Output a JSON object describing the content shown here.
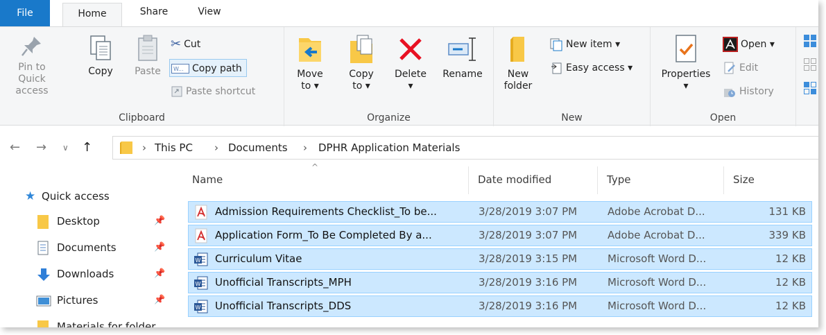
{
  "ribbon_tabs": {
    "file": "File",
    "home": "Home",
    "share": "Share",
    "view": "View"
  },
  "clipboard": {
    "pin": [
      "Pin to Quick",
      "access"
    ],
    "copy": "Copy",
    "paste": "Paste",
    "cut": "Cut",
    "copy_path": "Copy path",
    "paste_shortcut": "Paste shortcut",
    "label": "Clipboard"
  },
  "organize": {
    "move_to": [
      "Move",
      "to ▾"
    ],
    "copy_to": [
      "Copy",
      "to ▾"
    ],
    "delete": [
      "Delete",
      "▾"
    ],
    "rename": "Rename",
    "label": "Organize"
  },
  "new": {
    "new_folder": [
      "New",
      "folder"
    ],
    "new_item": "New item ▾",
    "easy_access": "Easy access ▾",
    "label": "New"
  },
  "open": {
    "properties": [
      "Properties",
      "▾"
    ],
    "open": "Open ▾",
    "edit": "Edit",
    "history": "History",
    "label": "Open"
  },
  "address": {
    "crumbs": [
      "This PC",
      "Documents",
      "DPHR  Application Materials"
    ]
  },
  "nav_pane": {
    "quick_access": "Quick access",
    "items": [
      "Desktop",
      "Documents",
      "Downloads",
      "Pictures",
      "Materials for folder"
    ]
  },
  "columns": {
    "name": "Name",
    "date": "Date modified",
    "type": "Type",
    "size": "Size"
  },
  "files": [
    {
      "icon": "pdf-icon",
      "name": "Admission Requirements Checklist_To be...",
      "date": "3/28/2019 3:07 PM",
      "type": "Adobe Acrobat D...",
      "size": "131 KB"
    },
    {
      "icon": "pdf-icon",
      "name": "Application Form_To Be Completed By a...",
      "date": "3/28/2019 3:07 PM",
      "type": "Adobe Acrobat D...",
      "size": "339 KB"
    },
    {
      "icon": "word-icon",
      "name": "Curriculum Vitae",
      "date": "3/28/2019 3:15 PM",
      "type": "Microsoft Word D...",
      "size": "12 KB"
    },
    {
      "icon": "word-icon",
      "name": "Unofficial Transcripts_MPH",
      "date": "3/28/2019 3:16 PM",
      "type": "Microsoft Word D...",
      "size": "12 KB"
    },
    {
      "icon": "word-icon",
      "name": "Unofficial Transcripts_DDS",
      "date": "3/28/2019 3:16 PM",
      "type": "Microsoft Word D...",
      "size": "12 KB"
    }
  ],
  "colors": {
    "accent": "#1979ca",
    "selection": "#cce8ff",
    "selection_border": "#99d1ff"
  }
}
